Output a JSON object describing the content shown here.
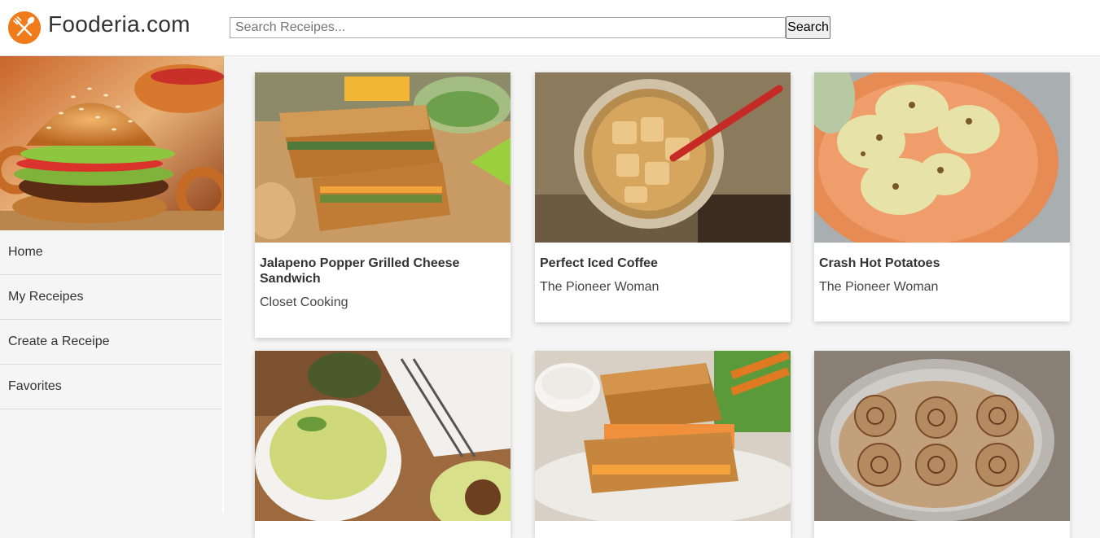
{
  "header": {
    "brand": "Fooderia.com",
    "logo_icon": "fork-knife-icon",
    "search_placeholder": "Search Receipes...",
    "search_button": "Search",
    "accent": "#f07b1a"
  },
  "sidebar": {
    "hero_image": "burger-photo",
    "items": [
      {
        "label": "Home"
      },
      {
        "label": "My Receipes"
      },
      {
        "label": "Create a Receipe"
      },
      {
        "label": "Favorites"
      }
    ]
  },
  "recipes": [
    {
      "title": "Jalapeno Popper Grilled Cheese Sandwich",
      "source": "Closet Cooking",
      "image": "grilled-cheese-photo"
    },
    {
      "title": "Perfect Iced Coffee",
      "source": "The Pioneer Woman",
      "image": "iced-coffee-photo"
    },
    {
      "title": "Crash Hot Potatoes",
      "source": "The Pioneer Woman",
      "image": "potatoes-photo"
    },
    {
      "title": "",
      "source": "",
      "image": "avocado-mac-photo"
    },
    {
      "title": "",
      "source": "",
      "image": "buffalo-grilled-cheese-photo"
    },
    {
      "title": "",
      "source": "",
      "image": "cinnamon-rolls-photo"
    }
  ]
}
